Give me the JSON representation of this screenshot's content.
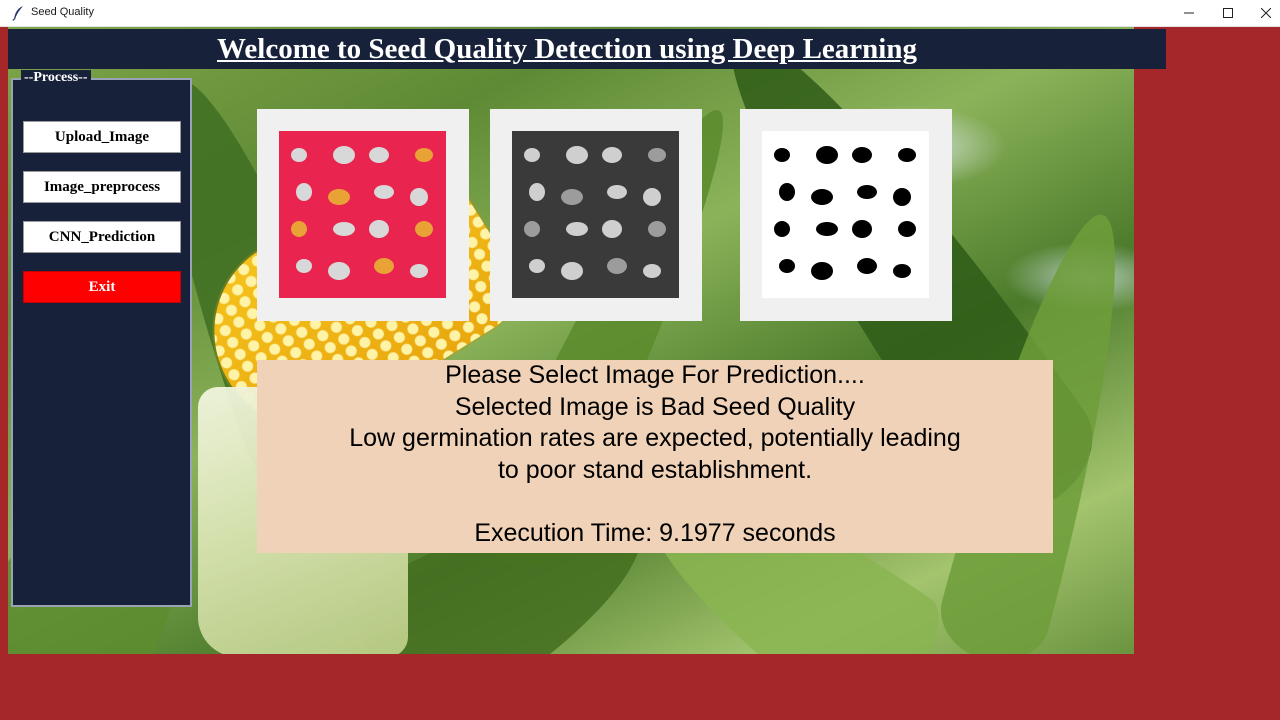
{
  "window": {
    "title": "Seed Quality",
    "icon": "feather-icon",
    "controls": [
      "minimize-icon",
      "maximize-icon",
      "close-icon"
    ]
  },
  "header": {
    "title": "Welcome to Seed Quality Detection using Deep Learning"
  },
  "sidebar": {
    "legend": "--Process--",
    "buttons": {
      "upload": "Upload_Image",
      "preprocess": "Image_preprocess",
      "predict": "CNN_Prediction",
      "exit": "Exit"
    }
  },
  "images": [
    {
      "kind": "original",
      "background": "#e8244f"
    },
    {
      "kind": "grayscale",
      "background": "#3a3a3a"
    },
    {
      "kind": "binary",
      "background": "#ffffff"
    }
  ],
  "result": {
    "lines": [
      "Please Select Image For Prediction....",
      "Selected Image is Bad Seed Quality",
      "Low germination rates are expected, potentially leading",
      "to poor stand establishment.",
      "",
      "Execution Time: 9.1977 seconds"
    ]
  },
  "colors": {
    "outer_background": "#a6272a",
    "navy": "#17223a",
    "exit_button": "#ff0000",
    "result_panel": "#efd2b7"
  }
}
